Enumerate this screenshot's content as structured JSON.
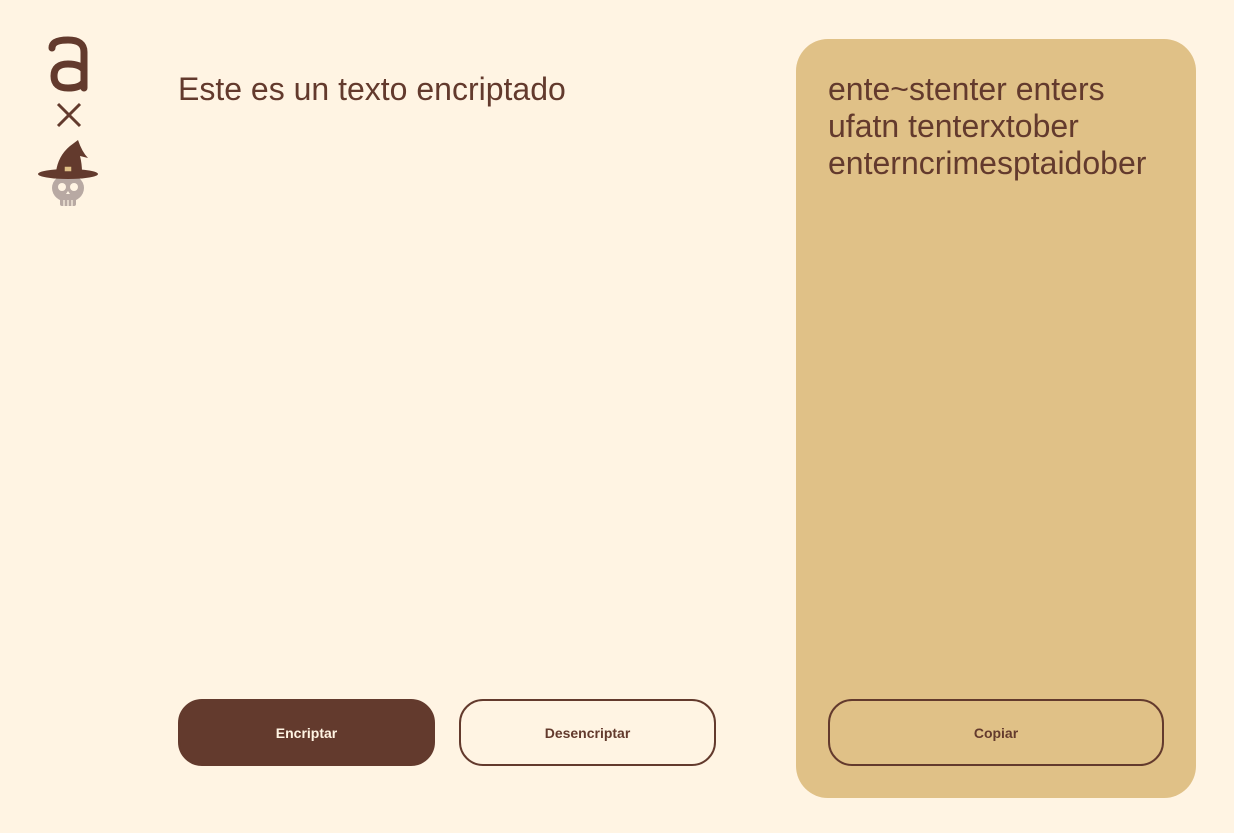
{
  "logo": {
    "icon": "alura-witch-skull-logo",
    "colors": {
      "brand_dark": "#633A2D",
      "skull_gray": "#B8A9A3"
    }
  },
  "input": {
    "value": "Este es un texto encriptado"
  },
  "buttons": {
    "encrypt_label": "Encriptar",
    "decrypt_label": "Desencriptar",
    "copy_label": "Copiar"
  },
  "output": {
    "text": "ente~stenter enters ufatn tenterxtober enterncrimesptaidober"
  },
  "colors": {
    "background": "#FFF4E3",
    "panel": "#E0C187",
    "primary": "#633A2D"
  }
}
